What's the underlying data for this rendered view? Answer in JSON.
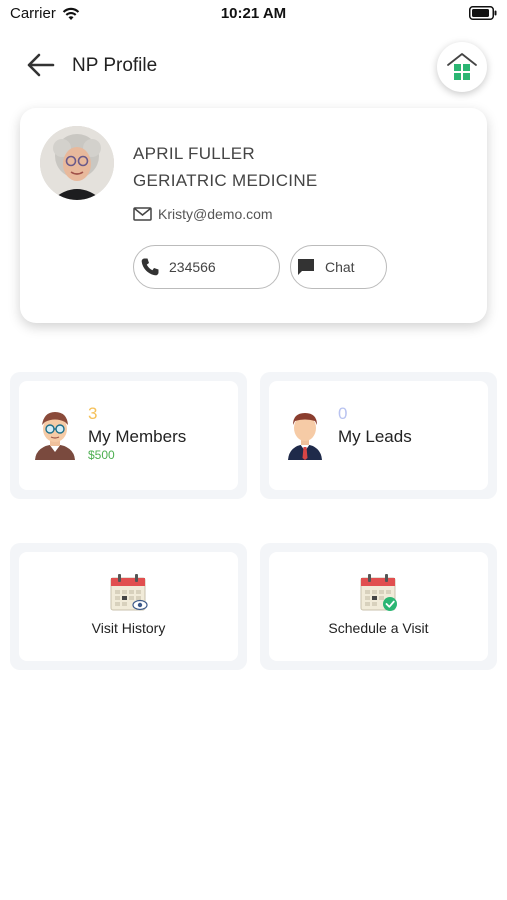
{
  "status_bar": {
    "carrier": "Carrier",
    "time": "10:21 AM",
    "icons": [
      "wifi-icon",
      "battery-icon"
    ]
  },
  "header": {
    "title": "NP Profile",
    "back_icon": "arrow-left-icon",
    "home_icon": "home-icon"
  },
  "profile": {
    "name": "APRIL FULLER",
    "specialty": "GERIATRIC MEDICINE",
    "email": "Kristy@demo.com",
    "phone": "234566",
    "chat_label": "Chat"
  },
  "tiles": {
    "members": {
      "count": "3",
      "label": "My Members",
      "amount": "$500",
      "count_color": "#f5c15a"
    },
    "leads": {
      "count": "0",
      "label": "My Leads",
      "count_color": "#b9c3f0"
    },
    "visit_history": {
      "label": "Visit History"
    },
    "schedule_visit": {
      "label": "Schedule a Visit"
    }
  },
  "colors": {
    "accent_green": "#2bb673",
    "calendar_red": "#e14f4f",
    "amount_green": "#4caf50"
  }
}
